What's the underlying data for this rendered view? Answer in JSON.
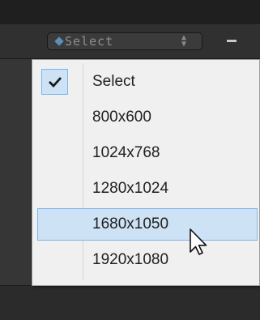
{
  "header": {
    "select": {
      "value": "Select",
      "icon": "diamond-icon",
      "arrows_icon": "up-down-arrows-icon"
    },
    "minus_icon": "minus-icon"
  },
  "dropdown": {
    "items": [
      {
        "label": "Select",
        "checked": true,
        "highlighted": false
      },
      {
        "label": "800x600",
        "checked": false,
        "highlighted": false
      },
      {
        "label": "1024x768",
        "checked": false,
        "highlighted": false
      },
      {
        "label": "1280x1024",
        "checked": false,
        "highlighted": false
      },
      {
        "label": "1680x1050",
        "checked": false,
        "highlighted": true
      },
      {
        "label": "1920x1080",
        "checked": false,
        "highlighted": false
      }
    ]
  },
  "colors": {
    "highlight": "#cde2f5",
    "highlight_border": "#7eb4ea",
    "menu_bg": "#f0f0f0"
  }
}
